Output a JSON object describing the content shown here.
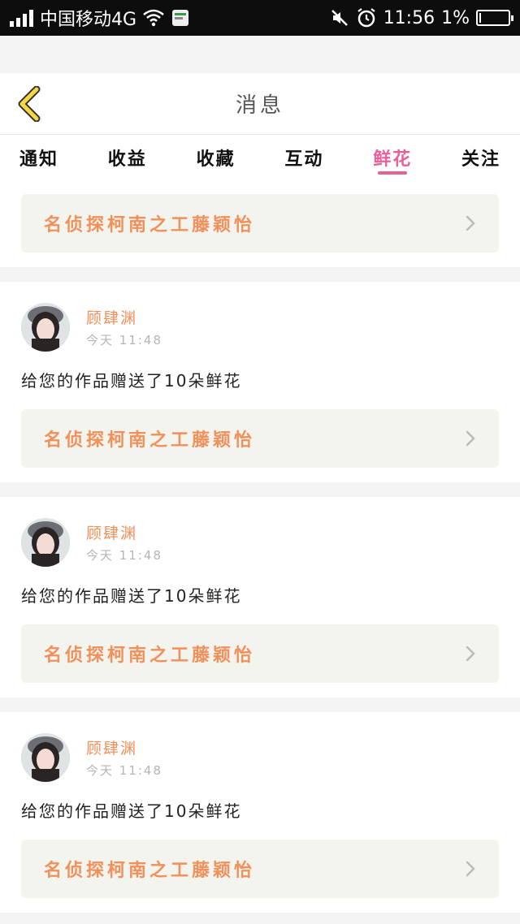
{
  "status_bar": {
    "carrier": "中国移动4G",
    "time": "11:56",
    "battery": "1%"
  },
  "header": {
    "title": "消息"
  },
  "tabs": [
    {
      "label": "通知",
      "active": false
    },
    {
      "label": "收益",
      "active": false
    },
    {
      "label": "收藏",
      "active": false
    },
    {
      "label": "互动",
      "active": false
    },
    {
      "label": "鲜花",
      "active": true
    },
    {
      "label": "关注",
      "active": false
    }
  ],
  "first_card": {
    "work_title": "名侦探柯南之工藤颖怡"
  },
  "messages": [
    {
      "user": "顾肆渊",
      "time": "今天 11:48",
      "text": "给您的作品赠送了10朵鲜花",
      "work_title": "名侦探柯南之工藤颖怡"
    },
    {
      "user": "顾肆渊",
      "time": "今天 11:48",
      "text": "给您的作品赠送了10朵鲜花",
      "work_title": "名侦探柯南之工藤颖怡"
    },
    {
      "user": "顾肆渊",
      "time": "今天 11:48",
      "text": "给您的作品赠送了10朵鲜花",
      "work_title": "名侦探柯南之工藤颖怡"
    }
  ],
  "colors": {
    "accent": "#e8609a",
    "work_title": "#f0905a",
    "back_arrow": "#f5d742"
  }
}
